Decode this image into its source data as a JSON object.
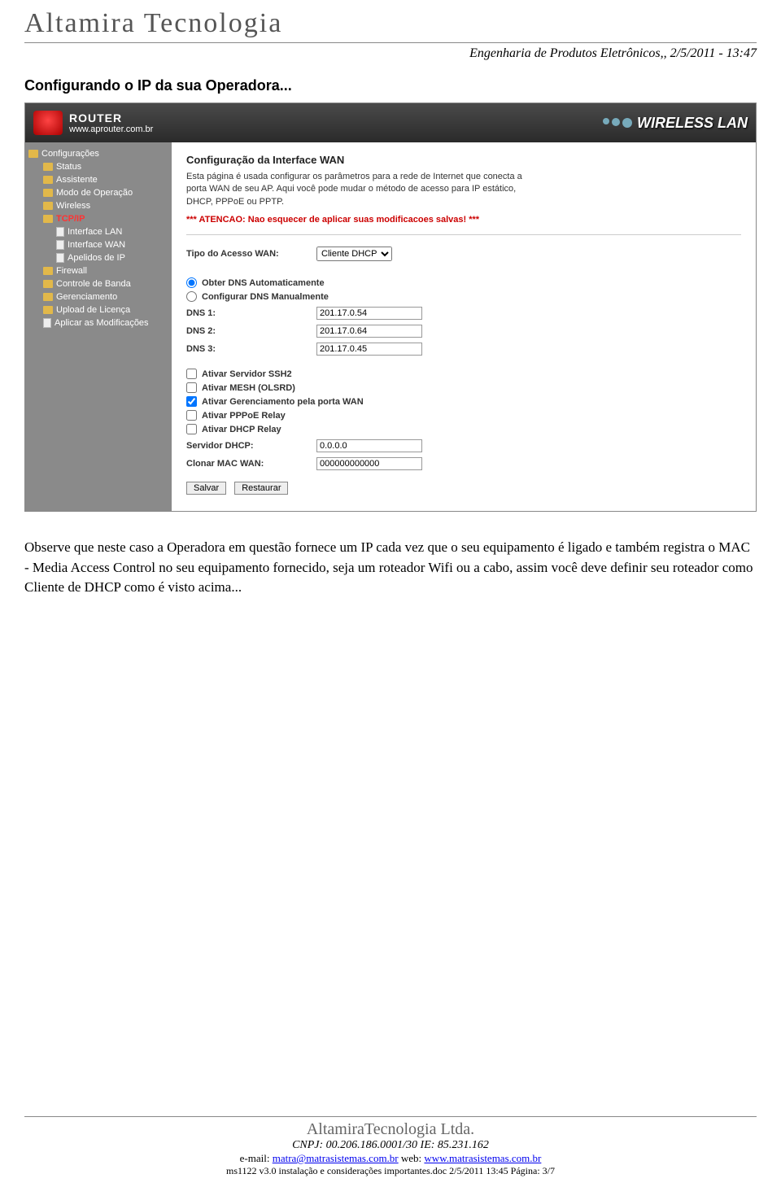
{
  "doc": {
    "title": "Altamira Tecnologia",
    "engLine": "Engenharia de Produtos Eletrônicos,,  2/5/2011 - 13:47",
    "sectionHeading": "Configurando o IP da sua Operadora..."
  },
  "router": {
    "brand": "ROUTER",
    "url": "www.aprouter.com.br",
    "wirelessLan": "WIRELESS LAN",
    "sidebar": [
      {
        "label": "Configurações",
        "type": "folder"
      },
      {
        "label": "Status",
        "type": "folder",
        "sub": true
      },
      {
        "label": "Assistente",
        "type": "folder",
        "sub": true
      },
      {
        "label": "Modo de Operação",
        "type": "folder",
        "sub": true
      },
      {
        "label": "Wireless",
        "type": "folder",
        "sub": true
      },
      {
        "label": "TCP/IP",
        "type": "folder",
        "sub": true,
        "active": true
      },
      {
        "label": "Interface LAN",
        "type": "page",
        "sub2": true
      },
      {
        "label": "Interface WAN",
        "type": "page",
        "sub2": true
      },
      {
        "label": "Apelidos de IP",
        "type": "page",
        "sub2": true
      },
      {
        "label": "Firewall",
        "type": "folder",
        "sub": true
      },
      {
        "label": "Controle de Banda",
        "type": "folder",
        "sub": true
      },
      {
        "label": "Gerenciamento",
        "type": "folder",
        "sub": true
      },
      {
        "label": "Upload de Licença",
        "type": "folder",
        "sub": true
      },
      {
        "label": "Aplicar as Modificações",
        "type": "page",
        "sub": true
      }
    ],
    "content": {
      "title": "Configuração da Interface WAN",
      "intro": "Esta página é usada configurar os parâmetros para a rede de Internet que conecta a porta WAN de seu AP. Aqui você pode mudar o método de acesso para IP estático, DHCP, PPPoE ou PPTP.",
      "warning": "*** ATENCAO: Nao esquecer de aplicar suas modificacoes salvas! ***",
      "fields": {
        "wanTypeLabel": "Tipo do Acesso WAN:",
        "wanTypeValue": "Cliente DHCP",
        "radioAuto": "Obter DNS Automaticamente",
        "radioManual": "Configurar DNS Manualmente",
        "dns1Label": "DNS 1:",
        "dns1": "201.17.0.54",
        "dns2Label": "DNS 2:",
        "dns2": "201.17.0.64",
        "dns3Label": "DNS 3:",
        "dns3": "201.17.0.45",
        "chkSSH": "Ativar Servidor SSH2",
        "chkMesh": "Ativar MESH (OLSRD)",
        "chkWanMgmt": "Ativar Gerenciamento pela porta WAN",
        "chkPppoe": "Ativar PPPoE Relay",
        "chkDhcp": "Ativar DHCP Relay",
        "dhcpServerLabel": "Servidor DHCP:",
        "dhcpServer": "0.0.0.0",
        "cloneMacLabel": "Clonar MAC WAN:",
        "cloneMac": "000000000000",
        "btnSave": "Salvar",
        "btnRestore": "Restaurar"
      }
    }
  },
  "bodyText": "Observe que neste caso a Operadora em questão fornece um IP cada vez que o seu equipamento é ligado e também registra o MAC - Media Access Control no seu equipamento fornecido, seja um roteador Wifi ou a cabo, assim você deve definir seu roteador como Cliente de DHCP como é visto acima...",
  "footer": {
    "company": "AltamiraTecnologia Ltda.",
    "cnpj": "CNPJ: 00.206.186.0001/30 IE: 85.231.162",
    "emailLabel": "e-mail: ",
    "email": "matra@matrasistemas.com.br",
    "webLabel": " web: ",
    "web": "www.matrasistemas.com.br",
    "meta": "ms1122 v3.0 instalação e considerações importantes.doc 2/5/2011 13:45 Página: 3/7"
  }
}
